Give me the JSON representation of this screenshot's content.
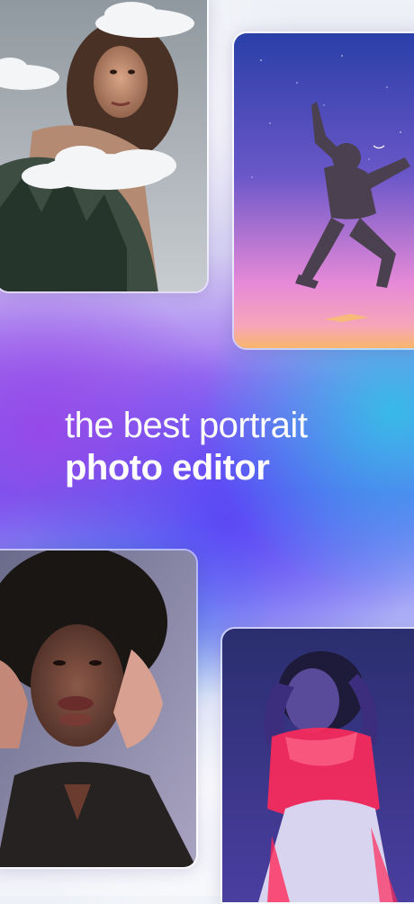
{
  "headline": {
    "line1": "the best portrait",
    "line2": "photo editor"
  },
  "photos": [
    {
      "id": "clouds",
      "subject": "woman-with-clouds-double-exposure"
    },
    {
      "id": "jump",
      "subject": "silhouette-jumping-at-dusk"
    },
    {
      "id": "afro",
      "subject": "woman-with-hands-on-face-motion-blur"
    },
    {
      "id": "neon",
      "subject": "woman-in-red-and-blue-neon-light"
    }
  ],
  "colors": {
    "text": "#ffffff",
    "accent_purple": "#6a5cf5",
    "accent_cyan": "#28c8e6"
  }
}
